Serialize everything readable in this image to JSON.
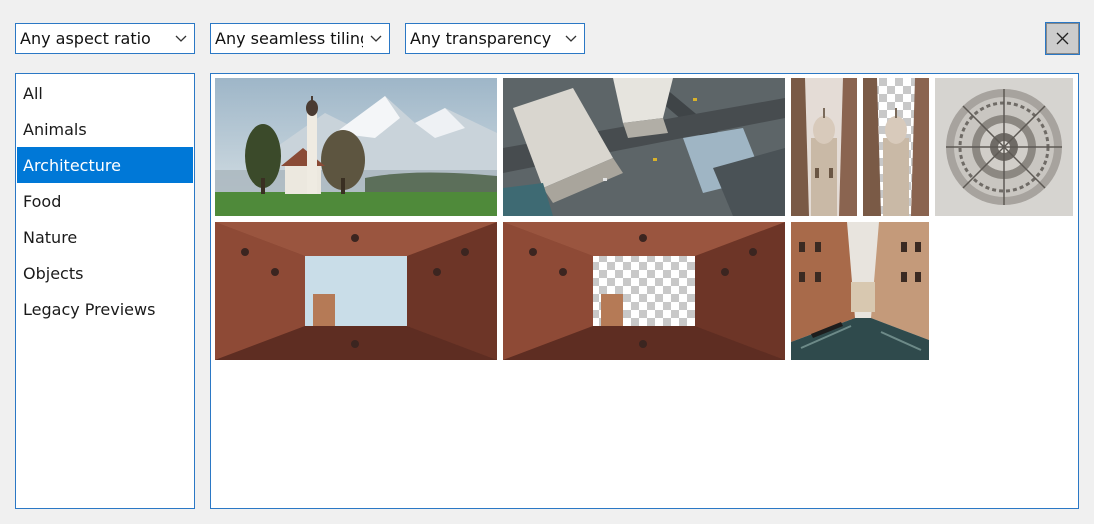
{
  "filters": {
    "aspect_ratio": "Any aspect ratio",
    "seamless_tiling": "Any seamless tiling",
    "transparency": "Any transparency"
  },
  "close_icon": "close-icon",
  "categories": {
    "items": [
      "All",
      "Animals",
      "Architecture",
      "Food",
      "Nature",
      "Objects",
      "Legacy Previews"
    ],
    "selected": "Architecture"
  },
  "thumbnails": [
    {
      "subject": "church-alps-thumbnail"
    },
    {
      "subject": "city-aerial-thumbnail"
    },
    {
      "subject": "cathedral-street-thumbnail"
    },
    {
      "subject": "cathedral-street-transparent-thumbnail"
    },
    {
      "subject": "rose-window-thumbnail"
    },
    {
      "subject": "courtyard-sky-thumbnail"
    },
    {
      "subject": "courtyard-transparent-thumbnail"
    },
    {
      "subject": "venice-canal-thumbnail"
    }
  ]
}
